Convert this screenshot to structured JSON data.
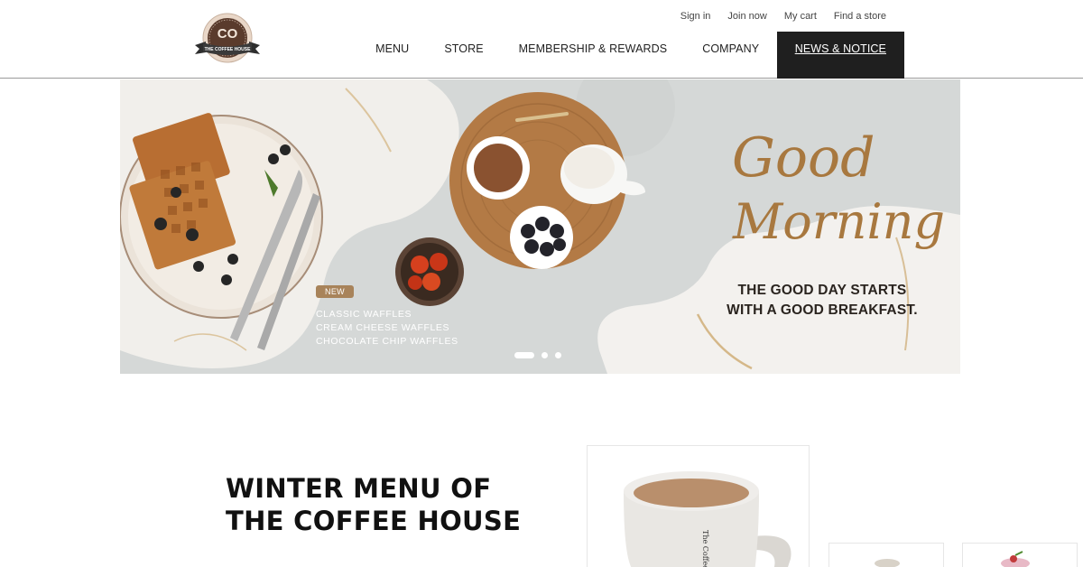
{
  "brand": {
    "logo_text": "THE COFFEE HOUSE",
    "logo_mark": "CO",
    "colors": {
      "logo_brown": "#5a3b2c",
      "ribbon": "#3a3a3a",
      "accent_gold": "#a8835a",
      "nav_active_bg": "#1f1f1f"
    }
  },
  "utility_nav": [
    {
      "label": "Sign in"
    },
    {
      "label": "Join now"
    },
    {
      "label": "My cart"
    },
    {
      "label": "Find a store"
    }
  ],
  "main_nav": [
    {
      "label": "MENU",
      "active": false
    },
    {
      "label": "STORE",
      "active": false
    },
    {
      "label": "MEMBERSHIP & REWARDS",
      "active": false
    },
    {
      "label": "COMPANY",
      "active": false
    },
    {
      "label": "NEWS & NOTICE",
      "active": true
    }
  ],
  "hero": {
    "badge": "NEW",
    "waffles": [
      "CLASSIC WAFFLES",
      "CREAM CHEESE WAFFLES",
      "CHOCOLATE CHIP WAFFLES"
    ],
    "script_line1": "Good",
    "script_line2": "Morning",
    "headline_line1": "THE GOOD DAY STARTS",
    "headline_line2": "WITH A GOOD BREAKFAST.",
    "slides": {
      "count": 3,
      "active_index": 0
    }
  },
  "section": {
    "title_line1": "WINTER MENU OF",
    "title_line2": "THE COFFEE HOUSE",
    "mug_print": "The Coffee"
  }
}
